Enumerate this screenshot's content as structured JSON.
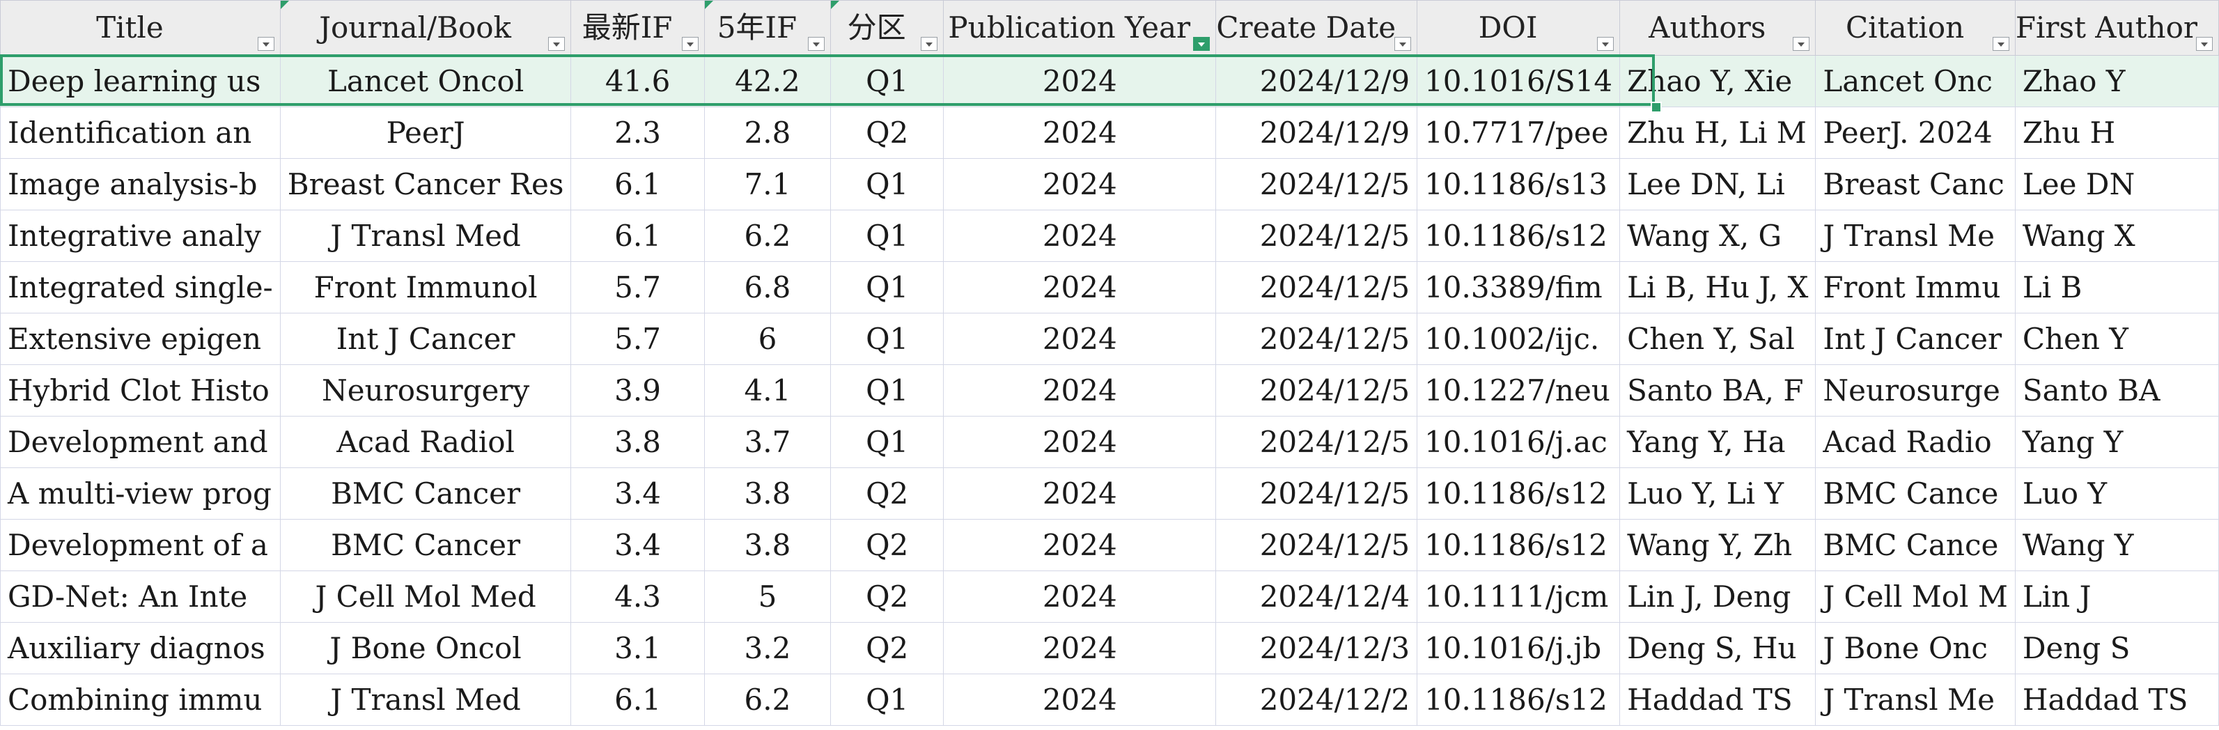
{
  "columns": [
    {
      "key": "title",
      "label": "Title",
      "align": "l"
    },
    {
      "key": "journal",
      "label": "Journal/Book",
      "align": "c"
    },
    {
      "key": "if_latest",
      "label": "最新IF",
      "align": "c"
    },
    {
      "key": "if_5yr",
      "label": "5年IF",
      "align": "c"
    },
    {
      "key": "quartile",
      "label": "分区",
      "align": "c"
    },
    {
      "key": "pub_year",
      "label": "Publication Year",
      "align": "c"
    },
    {
      "key": "create_date",
      "label": "Create Date",
      "align": "r"
    },
    {
      "key": "doi",
      "label": "DOI",
      "align": "l"
    },
    {
      "key": "authors",
      "label": "Authors",
      "align": "l"
    },
    {
      "key": "citation",
      "label": "Citation",
      "align": "l"
    },
    {
      "key": "first_author",
      "label": "First Author",
      "align": "l"
    }
  ],
  "rows": [
    {
      "title": "Deep learning us",
      "journal": "Lancet Oncol",
      "if_latest": "41.6",
      "if_5yr": "42.2",
      "quartile": "Q1",
      "pub_year": "2024",
      "create_date": "2024/12/9",
      "doi": "10.1016/S14",
      "authors": "Zhao Y, Xie",
      "citation": "Lancet Onc",
      "first_author": "Zhao Y"
    },
    {
      "title": "Identification an",
      "journal": "PeerJ",
      "if_latest": "2.3",
      "if_5yr": "2.8",
      "quartile": "Q2",
      "pub_year": "2024",
      "create_date": "2024/12/9",
      "doi": "10.7717/pee",
      "authors": "Zhu H, Li M",
      "citation": "PeerJ. 2024",
      "first_author": "Zhu H"
    },
    {
      "title": "Image analysis-b",
      "journal": "Breast Cancer Res",
      "if_latest": "6.1",
      "if_5yr": "7.1",
      "quartile": "Q1",
      "pub_year": "2024",
      "create_date": "2024/12/5",
      "doi": "10.1186/s13",
      "authors": "Lee DN, Li",
      "citation": "Breast Canc",
      "first_author": "Lee DN"
    },
    {
      "title": "Integrative analy",
      "journal": "J Transl Med",
      "if_latest": "6.1",
      "if_5yr": "6.2",
      "quartile": "Q1",
      "pub_year": "2024",
      "create_date": "2024/12/5",
      "doi": "10.1186/s12",
      "authors": "Wang X, G",
      "citation": "J Transl Me",
      "first_author": "Wang X"
    },
    {
      "title": "Integrated single-",
      "journal": "Front Immunol",
      "if_latest": "5.7",
      "if_5yr": "6.8",
      "quartile": "Q1",
      "pub_year": "2024",
      "create_date": "2024/12/5",
      "doi": "10.3389/fim",
      "authors": "Li B, Hu J, X",
      "citation": "Front Immu",
      "first_author": "Li B"
    },
    {
      "title": "Extensive epigen",
      "journal": "Int J Cancer",
      "if_latest": "5.7",
      "if_5yr": "6",
      "quartile": "Q1",
      "pub_year": "2024",
      "create_date": "2024/12/5",
      "doi": "10.1002/ijc.",
      "authors": "Chen Y, Sal",
      "citation": "Int J Cancer",
      "first_author": "Chen Y"
    },
    {
      "title": "Hybrid Clot Histo",
      "journal": "Neurosurgery",
      "if_latest": "3.9",
      "if_5yr": "4.1",
      "quartile": "Q1",
      "pub_year": "2024",
      "create_date": "2024/12/5",
      "doi": "10.1227/neu",
      "authors": "Santo BA, F",
      "citation": "Neurosurge",
      "first_author": "Santo BA"
    },
    {
      "title": "Development and",
      "journal": "Acad Radiol",
      "if_latest": "3.8",
      "if_5yr": "3.7",
      "quartile": "Q1",
      "pub_year": "2024",
      "create_date": "2024/12/5",
      "doi": "10.1016/j.ac",
      "authors": "Yang Y, Ha",
      "citation": "Acad Radio",
      "first_author": "Yang Y"
    },
    {
      "title": "A multi-view prog",
      "journal": "BMC Cancer",
      "if_latest": "3.4",
      "if_5yr": "3.8",
      "quartile": "Q2",
      "pub_year": "2024",
      "create_date": "2024/12/5",
      "doi": "10.1186/s12",
      "authors": "Luo Y, Li Y",
      "citation": "BMC Cance",
      "first_author": "Luo Y"
    },
    {
      "title": "Development of a",
      "journal": "BMC Cancer",
      "if_latest": "3.4",
      "if_5yr": "3.8",
      "quartile": "Q2",
      "pub_year": "2024",
      "create_date": "2024/12/5",
      "doi": "10.1186/s12",
      "authors": "Wang Y, Zh",
      "citation": "BMC Cance",
      "first_author": "Wang Y"
    },
    {
      "title": "GD-Net: An Inte",
      "journal": "J Cell Mol Med",
      "if_latest": "4.3",
      "if_5yr": "5",
      "quartile": "Q2",
      "pub_year": "2024",
      "create_date": "2024/12/4",
      "doi": "10.1111/jcm",
      "authors": "Lin J, Deng",
      "citation": "J Cell Mol M",
      "first_author": "Lin J"
    },
    {
      "title": "Auxiliary diagnos",
      "journal": "J Bone Oncol",
      "if_latest": "3.1",
      "if_5yr": "3.2",
      "quartile": "Q2",
      "pub_year": "2024",
      "create_date": "2024/12/3",
      "doi": "10.1016/j.jb",
      "authors": "Deng S, Hu",
      "citation": "J Bone Onc",
      "first_author": "Deng S"
    },
    {
      "title": "Combining immu",
      "journal": "J Transl Med",
      "if_latest": "6.1",
      "if_5yr": "6.2",
      "quartile": "Q1",
      "pub_year": "2024",
      "create_date": "2024/12/2",
      "doi": "10.1186/s12",
      "authors": "Haddad TS",
      "citation": "J Transl Me",
      "first_author": "Haddad TS"
    }
  ],
  "selected_row": 0,
  "filter_active_column": "pub_year",
  "accent_color": "#2e9e6b"
}
